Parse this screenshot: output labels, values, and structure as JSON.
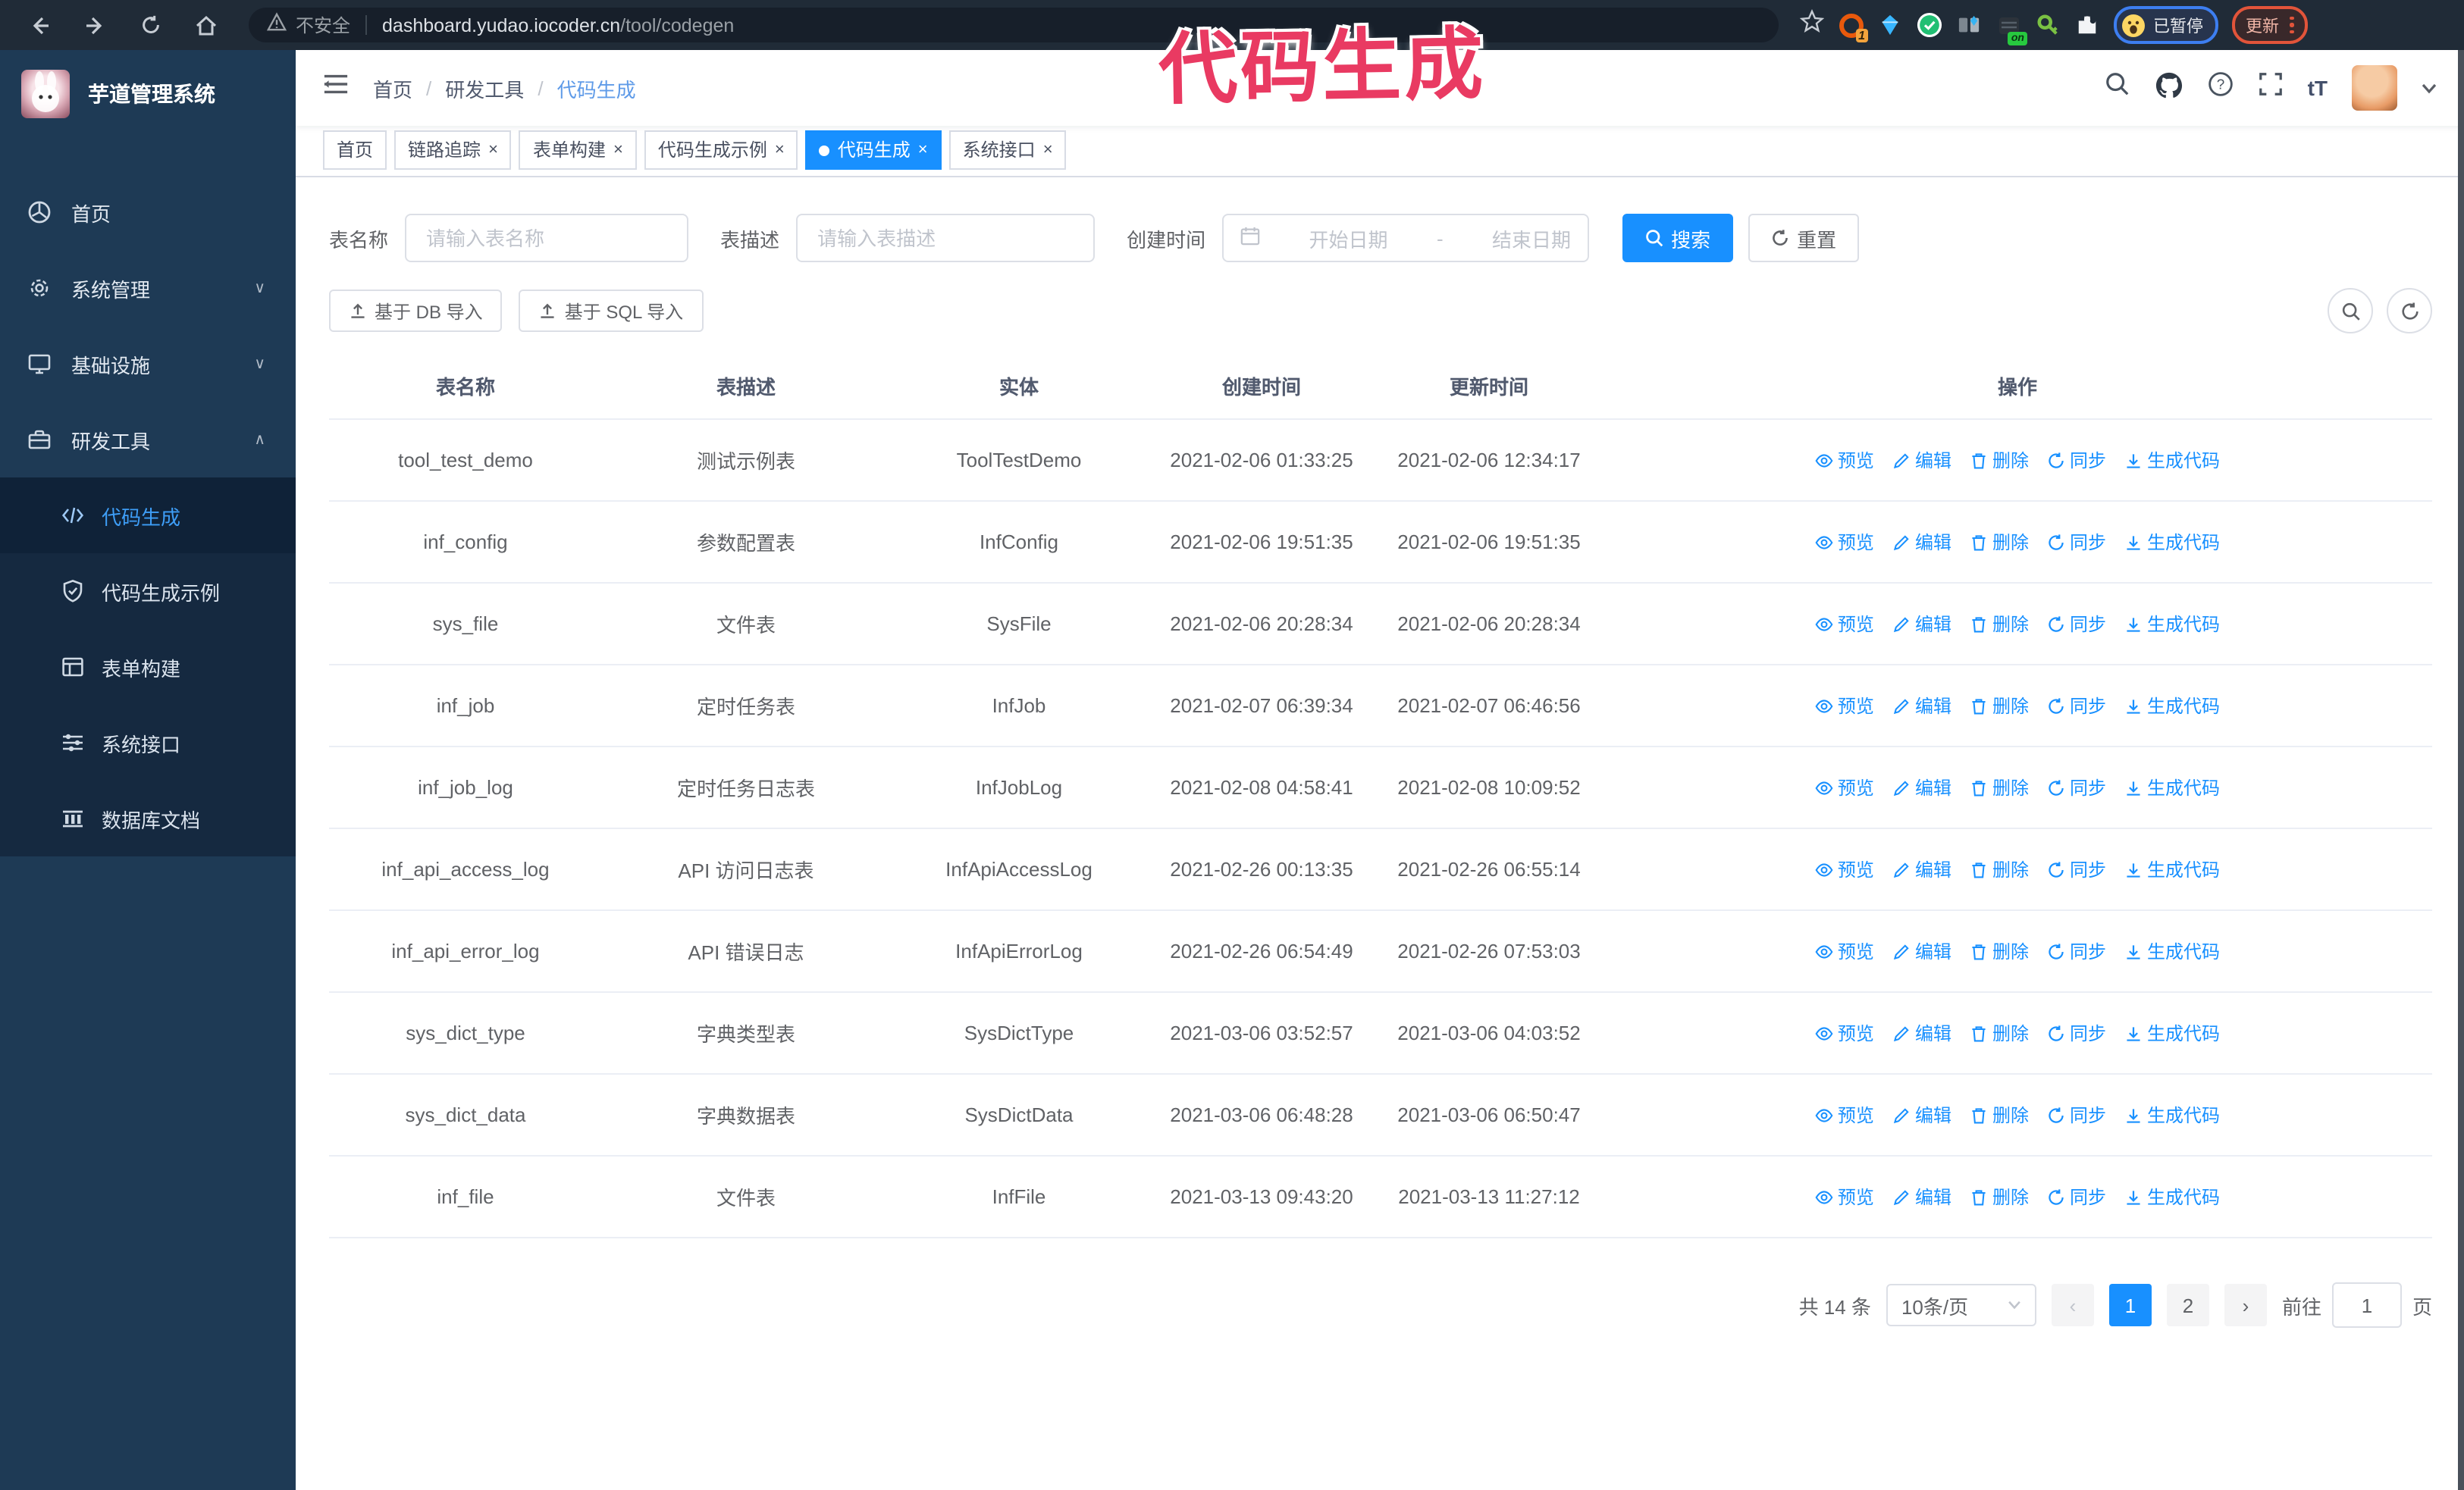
{
  "annotation": {
    "text": "代码生成"
  },
  "browser": {
    "insecure_label": "不安全",
    "url_domain": "dashboard.yudao.iocoder.cn",
    "url_path": "/tool/codegen",
    "extension_badge": "1",
    "extension_on_badge": "on",
    "paused_badge": "已暂停",
    "update_button": "更新"
  },
  "sidebar": {
    "title": "芋道管理系统",
    "items": [
      {
        "label": "首页",
        "icon": "dashboard-icon",
        "chevron": ""
      },
      {
        "label": "系统管理",
        "icon": "gear-icon",
        "chevron": "down"
      },
      {
        "label": "基础设施",
        "icon": "monitor-icon",
        "chevron": "down"
      },
      {
        "label": "研发工具",
        "icon": "toolbox-icon",
        "chevron": "up"
      }
    ],
    "subitems": [
      {
        "label": "代码生成",
        "icon": "code-icon",
        "active": true
      },
      {
        "label": "代码生成示例",
        "icon": "shield-check-icon",
        "active": false
      },
      {
        "label": "表单构建",
        "icon": "form-icon",
        "active": false
      },
      {
        "label": "系统接口",
        "icon": "sliders-icon",
        "active": false
      },
      {
        "label": "数据库文档",
        "icon": "columns-icon",
        "active": false
      }
    ]
  },
  "header": {
    "breadcrumb": [
      "首页",
      "研发工具",
      "代码生成"
    ]
  },
  "tabs": [
    {
      "label": "首页",
      "closable": false,
      "active": false
    },
    {
      "label": "链路追踪",
      "closable": true,
      "active": false
    },
    {
      "label": "表单构建",
      "closable": true,
      "active": false
    },
    {
      "label": "代码生成示例",
      "closable": true,
      "active": false
    },
    {
      "label": "代码生成",
      "closable": true,
      "active": true
    },
    {
      "label": "系统接口",
      "closable": true,
      "active": false
    }
  ],
  "filters": {
    "name_label": "表名称",
    "name_placeholder": "请输入表名称",
    "desc_label": "表描述",
    "desc_placeholder": "请输入表描述",
    "time_label": "创建时间",
    "start_placeholder": "开始日期",
    "range_separator": "-",
    "end_placeholder": "结束日期",
    "search_label": "搜索",
    "reset_label": "重置"
  },
  "toolbar": {
    "import_db_label": "基于 DB 导入",
    "import_sql_label": "基于 SQL 导入"
  },
  "table": {
    "columns": [
      "表名称",
      "表描述",
      "实体",
      "创建时间",
      "更新时间",
      "操作"
    ],
    "action_labels": [
      "预览",
      "编辑",
      "删除",
      "同步",
      "生成代码"
    ],
    "action_icons": [
      "eye-icon",
      "edit-icon",
      "trash-icon",
      "sync-icon",
      "download-icon"
    ],
    "rows": [
      {
        "name": "tool_test_demo",
        "desc": "测试示例表",
        "entity": "ToolTestDemo",
        "created": "2021-02-06 01:33:25",
        "updated": "2021-02-06 12:34:17"
      },
      {
        "name": "inf_config",
        "desc": "参数配置表",
        "entity": "InfConfig",
        "created": "2021-02-06 19:51:35",
        "updated": "2021-02-06 19:51:35"
      },
      {
        "name": "sys_file",
        "desc": "文件表",
        "entity": "SysFile",
        "created": "2021-02-06 20:28:34",
        "updated": "2021-02-06 20:28:34"
      },
      {
        "name": "inf_job",
        "desc": "定时任务表",
        "entity": "InfJob",
        "created": "2021-02-07 06:39:34",
        "updated": "2021-02-07 06:46:56"
      },
      {
        "name": "inf_job_log",
        "desc": "定时任务日志表",
        "entity": "InfJobLog",
        "created": "2021-02-08 04:58:41",
        "updated": "2021-02-08 10:09:52"
      },
      {
        "name": "inf_api_access_log",
        "desc": "API 访问日志表",
        "entity": "InfApiAccessLog",
        "created": "2021-02-26 00:13:35",
        "updated": "2021-02-26 06:55:14"
      },
      {
        "name": "inf_api_error_log",
        "desc": "API 错误日志",
        "entity": "InfApiErrorLog",
        "created": "2021-02-26 06:54:49",
        "updated": "2021-02-26 07:53:03"
      },
      {
        "name": "sys_dict_type",
        "desc": "字典类型表",
        "entity": "SysDictType",
        "created": "2021-03-06 03:52:57",
        "updated": "2021-03-06 04:03:52"
      },
      {
        "name": "sys_dict_data",
        "desc": "字典数据表",
        "entity": "SysDictData",
        "created": "2021-03-06 06:48:28",
        "updated": "2021-03-06 06:50:47"
      },
      {
        "name": "inf_file",
        "desc": "文件表",
        "entity": "InfFile",
        "created": "2021-03-13 09:43:20",
        "updated": "2021-03-13 11:27:12"
      }
    ]
  },
  "pagination": {
    "total_text": "共 14 条",
    "page_size": "10条/页",
    "pages": [
      "1",
      "2"
    ],
    "active_page": "1",
    "goto_label": "前往",
    "goto_value": "1",
    "goto_suffix": "页"
  },
  "colors": {
    "primary": "#1890ff",
    "sidebar_bg": "#1e3a55",
    "submenu_bg": "#152940",
    "annotation": "#e93a62"
  }
}
